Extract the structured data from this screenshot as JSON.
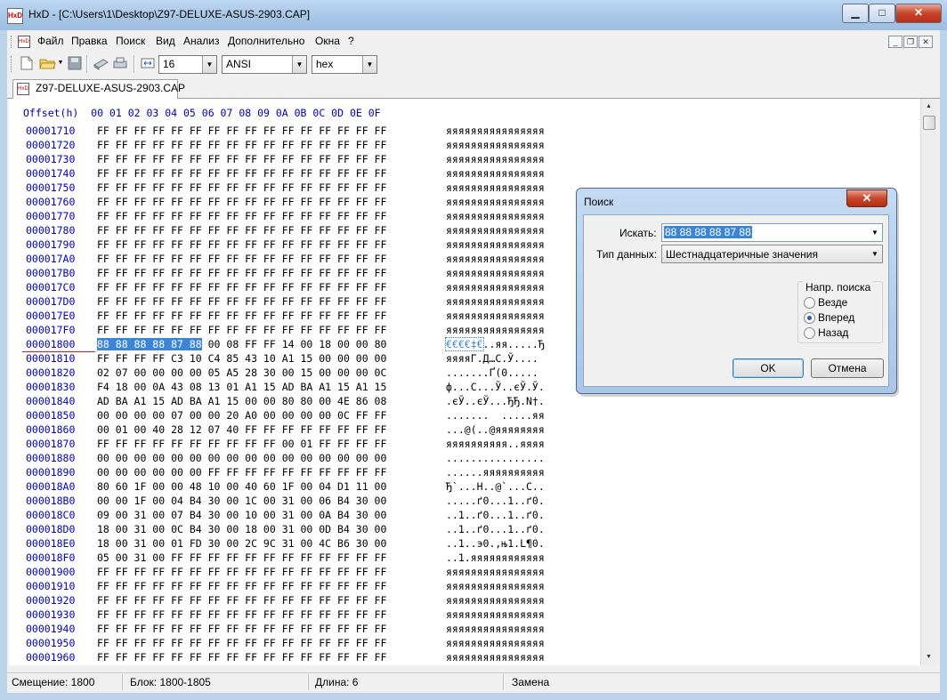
{
  "window": {
    "app_icon": "hxd-logo-icon",
    "title": "HxD - [C:\\Users\\1\\Desktop\\Z97-DELUXE-ASUS-2903.CAP]",
    "buttons": {
      "minimize": "▁",
      "maximize": "□",
      "close": "✕"
    }
  },
  "menu": {
    "items": [
      "Файл",
      "Правка",
      "Поиск",
      "Вид",
      "Анализ",
      "Дополнительно",
      "Окна",
      "?"
    ],
    "mdi_buttons": [
      "_",
      "❐",
      "✕"
    ]
  },
  "toolbar": {
    "icons": [
      "new-file-icon",
      "open-folder-icon",
      "save-icon",
      "ram-icon",
      "disk-icon",
      "columns-icon"
    ],
    "bytes_per_row": "16",
    "charset": "ANSI",
    "offset_base": "hex"
  },
  "tabs": [
    {
      "label": "Z97-DELUXE-ASUS-2903.CAP",
      "active": true
    }
  ],
  "hex": {
    "header": "Offset(h)  00 01 02 03 04 05 06 07 08 09 0A 0B 0C 0D 0E 0F",
    "rows": [
      {
        "offset": "00001710",
        "bytes": "FF FF FF FF FF FF FF FF FF FF FF FF FF FF FF FF",
        "text": "яяяяяяяяяяяяяяяя"
      },
      {
        "offset": "00001720",
        "bytes": "FF FF FF FF FF FF FF FF FF FF FF FF FF FF FF FF",
        "text": "яяяяяяяяяяяяяяяя"
      },
      {
        "offset": "00001730",
        "bytes": "FF FF FF FF FF FF FF FF FF FF FF FF FF FF FF FF",
        "text": "яяяяяяяяяяяяяяяя"
      },
      {
        "offset": "00001740",
        "bytes": "FF FF FF FF FF FF FF FF FF FF FF FF FF FF FF FF",
        "text": "яяяяяяяяяяяяяяяя"
      },
      {
        "offset": "00001750",
        "bytes": "FF FF FF FF FF FF FF FF FF FF FF FF FF FF FF FF",
        "text": "яяяяяяяяяяяяяяяя"
      },
      {
        "offset": "00001760",
        "bytes": "FF FF FF FF FF FF FF FF FF FF FF FF FF FF FF FF",
        "text": "яяяяяяяяяяяяяяяя"
      },
      {
        "offset": "00001770",
        "bytes": "FF FF FF FF FF FF FF FF FF FF FF FF FF FF FF FF",
        "text": "яяяяяяяяяяяяяяяя"
      },
      {
        "offset": "00001780",
        "bytes": "FF FF FF FF FF FF FF FF FF FF FF FF FF FF FF FF",
        "text": "яяяяяяяяяяяяяяяя"
      },
      {
        "offset": "00001790",
        "bytes": "FF FF FF FF FF FF FF FF FF FF FF FF FF FF FF FF",
        "text": "яяяяяяяяяяяяяяяя"
      },
      {
        "offset": "000017A0",
        "bytes": "FF FF FF FF FF FF FF FF FF FF FF FF FF FF FF FF",
        "text": "яяяяяяяяяяяяяяяя"
      },
      {
        "offset": "000017B0",
        "bytes": "FF FF FF FF FF FF FF FF FF FF FF FF FF FF FF FF",
        "text": "яяяяяяяяяяяяяяяя"
      },
      {
        "offset": "000017C0",
        "bytes": "FF FF FF FF FF FF FF FF FF FF FF FF FF FF FF FF",
        "text": "яяяяяяяяяяяяяяяя"
      },
      {
        "offset": "000017D0",
        "bytes": "FF FF FF FF FF FF FF FF FF FF FF FF FF FF FF FF",
        "text": "яяяяяяяяяяяяяяяя"
      },
      {
        "offset": "000017E0",
        "bytes": "FF FF FF FF FF FF FF FF FF FF FF FF FF FF FF FF",
        "text": "яяяяяяяяяяяяяяяя"
      },
      {
        "offset": "000017F0",
        "bytes": "FF FF FF FF FF FF FF FF FF FF FF FF FF FF FF FF",
        "text": "яяяяяяяяяяяяяяяя"
      },
      {
        "offset": "00001800",
        "sel_bytes": "88 88 88 88 87 88",
        "bytes": " 00 08 FF FF 14 00 18 00 00 80",
        "sel_text": "€€€€‡€",
        "text": "..яя.....Ђ"
      },
      {
        "offset": "00001810",
        "bytes": "FF FF FF FF C3 10 C4 85 43 10 A1 15 00 00 00 00",
        "text": "яяяяГ.Д…С.Ў...."
      },
      {
        "offset": "00001820",
        "bytes": "02 07 00 00 00 00 05 A5 28 30 00 15 00 00 00 0C",
        "text": ".......Ґ(0....."
      },
      {
        "offset": "00001830",
        "bytes": "F4 18 00 0A 43 08 13 01 A1 15 AD BA A1 15 A1 15",
        "text": "ф...С...Ў..єЎ.Ў."
      },
      {
        "offset": "00001840",
        "bytes": "AD BA A1 15 AD BA A1 15 00 00 80 80 00 4E 86 08",
        "text": ".єЎ..єЎ...ЂЂ.N†."
      },
      {
        "offset": "00001850",
        "bytes": "00 00 00 00 07 00 00 20 A0 00 00 00 00 0C FF FF",
        "text": ".......  .....яя"
      },
      {
        "offset": "00001860",
        "bytes": "00 01 00 40 28 12 07 40 FF FF FF FF FF FF FF FF",
        "text": "...@(..@яяяяяяяя"
      },
      {
        "offset": "00001870",
        "bytes": "FF FF FF FF FF FF FF FF FF FF 00 01 FF FF FF FF",
        "text": "яяяяяяяяяя..яяяя"
      },
      {
        "offset": "00001880",
        "bytes": "00 00 00 00 00 00 00 00 00 00 00 00 00 00 00 00",
        "text": "................"
      },
      {
        "offset": "00001890",
        "bytes": "00 00 00 00 00 00 FF FF FF FF FF FF FF FF FF FF",
        "text": "......яяяяяяяяяя"
      },
      {
        "offset": "000018A0",
        "bytes": "80 60 1F 00 00 48 10 00 40 60 1F 00 04 D1 11 00",
        "text": "Ђ`...H..@`...С.."
      },
      {
        "offset": "000018B0",
        "bytes": "00 00 1F 00 04 B4 30 00 1C 00 31 00 06 B4 30 00",
        "text": ".....ґ0...1..ґ0."
      },
      {
        "offset": "000018C0",
        "bytes": "09 00 31 00 07 B4 30 00 10 00 31 00 0A B4 30 00",
        "text": "..1..ґ0...1..ґ0."
      },
      {
        "offset": "000018D0",
        "bytes": "18 00 31 00 0C B4 30 00 18 00 31 00 0D B4 30 00",
        "text": "..1..ґ0...1..ґ0."
      },
      {
        "offset": "000018E0",
        "bytes": "18 00 31 00 01 FD 30 00 2C 9C 31 00 4C B6 30 00",
        "text": "..1..э0.,њ1.L¶0."
      },
      {
        "offset": "000018F0",
        "bytes": "05 00 31 00 FF FF FF FF FF FF FF FF FF FF FF FF",
        "text": "..1.яяяяяяяяяяяя"
      },
      {
        "offset": "00001900",
        "bytes": "FF FF FF FF FF FF FF FF FF FF FF FF FF FF FF FF",
        "text": "яяяяяяяяяяяяяяяя"
      },
      {
        "offset": "00001910",
        "bytes": "FF FF FF FF FF FF FF FF FF FF FF FF FF FF FF FF",
        "text": "яяяяяяяяяяяяяяяя"
      },
      {
        "offset": "00001920",
        "bytes": "FF FF FF FF FF FF FF FF FF FF FF FF FF FF FF FF",
        "text": "яяяяяяяяяяяяяяяя"
      },
      {
        "offset": "00001930",
        "bytes": "FF FF FF FF FF FF FF FF FF FF FF FF FF FF FF FF",
        "text": "яяяяяяяяяяяяяяяя"
      },
      {
        "offset": "00001940",
        "bytes": "FF FF FF FF FF FF FF FF FF FF FF FF FF FF FF FF",
        "text": "яяяяяяяяяяяяяяяя"
      },
      {
        "offset": "00001950",
        "bytes": "FF FF FF FF FF FF FF FF FF FF FF FF FF FF FF FF",
        "text": "яяяяяяяяяяяяяяяя"
      },
      {
        "offset": "00001960",
        "bytes": "FF FF FF FF FF FF FF FF FF FF FF FF FF FF FF FF",
        "text": "яяяяяяяяяяяяяяяя"
      }
    ]
  },
  "status": {
    "offset": "Смещение: 1800",
    "block": "Блок: 1800-1805",
    "length": "Длина: 6",
    "mode": "Замена"
  },
  "dialog": {
    "title": "Поиск",
    "search_label": "Искать:",
    "search_value": "88 88 88 88 87 88",
    "datatype_label": "Тип данных:",
    "datatype_value": "Шестнадцатеричные значения",
    "direction_label": "Напр. поиска",
    "directions": [
      {
        "label": "Везде",
        "checked": false
      },
      {
        "label": "Вперед",
        "checked": true
      },
      {
        "label": "Назад",
        "checked": false
      }
    ],
    "ok_label": "OK",
    "cancel_label": "Отмена"
  }
}
